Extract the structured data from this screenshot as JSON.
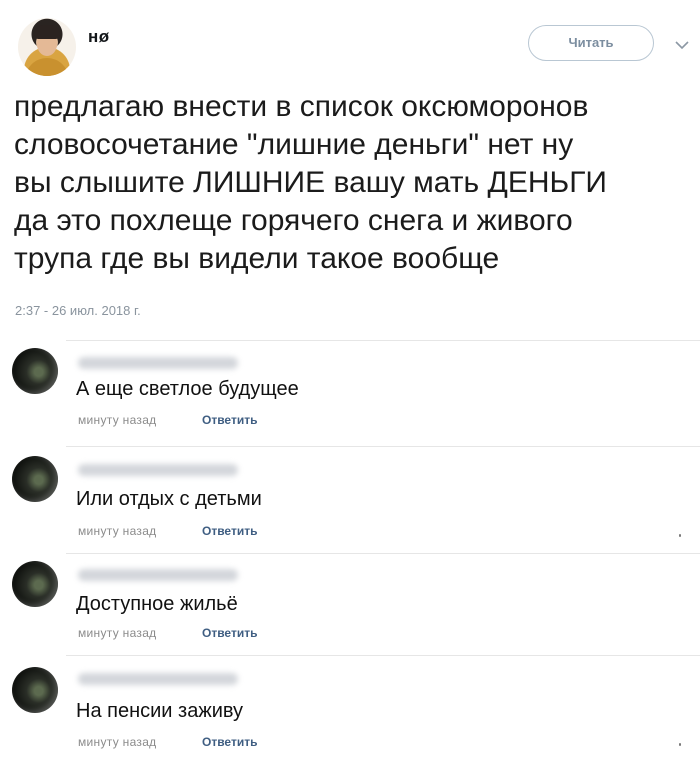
{
  "tweet": {
    "author": "нø",
    "follow_label": "Читать",
    "text": "предлагаю внести в список оксюморонов\nсловосочетание \"лишние деньги\" нет ну\nвы слышите ЛИШНИЕ вашу мать ДЕНЬГИ\nда это похлеще горячего снега и живого\nтрупа где вы видели такое вообще",
    "time": "2:37 - 26 июл. 2018 г."
  },
  "comments": [
    {
      "text": "А еще светлое будущее",
      "time": "минуту назад",
      "reply_label": "Ответить"
    },
    {
      "text": "Или отдых с детьми",
      "time": "минуту назад",
      "reply_label": "Ответить"
    },
    {
      "text": "Доступное жильё",
      "time": "минуту назад",
      "reply_label": "Ответить"
    },
    {
      "text": "На пенсии заживу",
      "time": "минуту назад",
      "reply_label": "Ответить"
    }
  ],
  "icons": {
    "chevron": "chevron-down-icon"
  }
}
